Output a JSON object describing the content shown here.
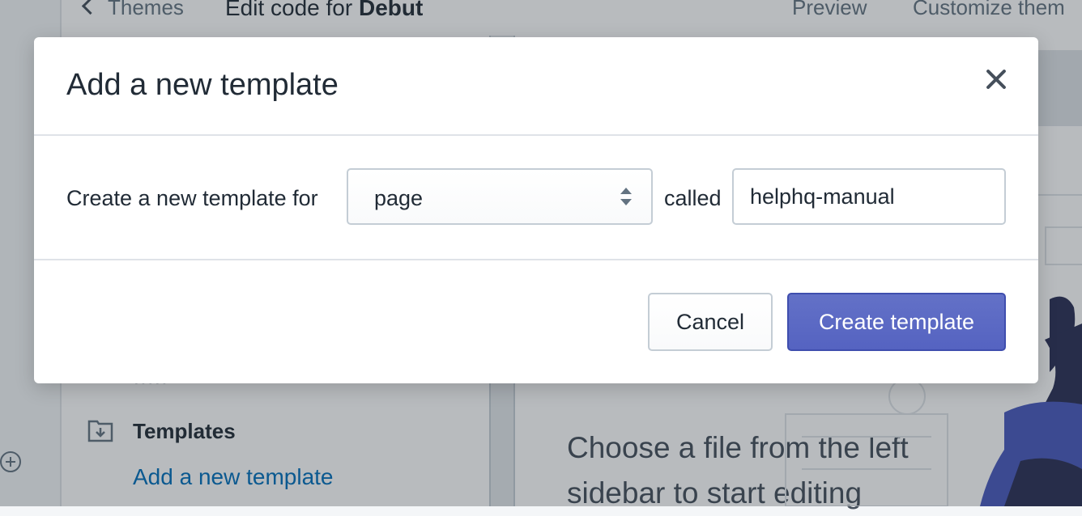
{
  "app": {
    "back_label": "Themes",
    "heading_prefix": "Edit code for ",
    "theme_name": "Debut",
    "preview_label": "Preview",
    "customize_label": "Customize them"
  },
  "sidebar": {
    "section_label": "Templates",
    "add_link": "Add a new template"
  },
  "main": {
    "placeholder_text": "Choose a file from the left sidebar to start editing"
  },
  "modal": {
    "title": "Add a new template",
    "for_label": "Create a new template for",
    "selected_type": "page",
    "called_label": "called",
    "name_value": "helphq-manual",
    "cancel_label": "Cancel",
    "create_label": "Create template"
  },
  "colors": {
    "primary": "#5c6ac4",
    "link": "#006fbb",
    "overlay": "rgba(33,43,54,0.32)"
  }
}
